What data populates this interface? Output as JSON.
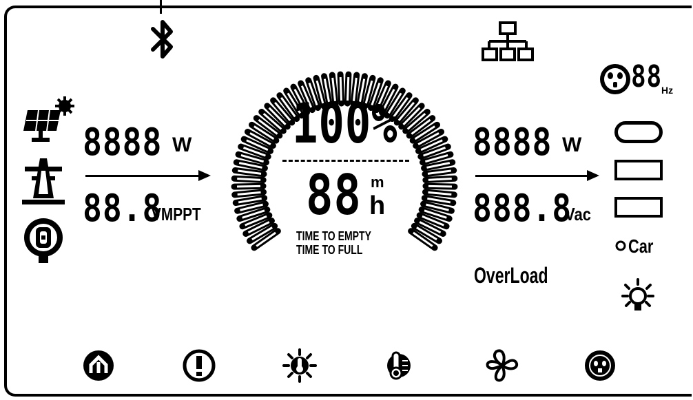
{
  "display": {
    "battery_percent": "100%",
    "time_value": "88",
    "time_unit_minutes": "m",
    "time_unit_hours": "h",
    "time_to_empty_label": "TIME TO EMPTY",
    "time_to_full_label": "TIME TO FULL",
    "gauge_segments": 60
  },
  "input": {
    "power_value": "8888",
    "power_unit": "W",
    "voltage_value": "88.8",
    "voltage_unit": "VMPPT"
  },
  "output": {
    "power_value": "8888",
    "power_unit": "W",
    "voltage_value": "888.8",
    "voltage_unit": "Vac",
    "frequency_value": "88",
    "frequency_unit": "Hz",
    "overload_label": "OverLoad",
    "car_label": "Car"
  },
  "icons": {
    "top": [
      "bluetooth-icon",
      "network-icon"
    ],
    "left": [
      "solar-panel-icon",
      "power-tower-icon",
      "dc-input-port-icon"
    ],
    "right": [
      "ac-outlet-icon",
      "usb-c-port-icon",
      "usb-a-port-icon",
      "usb-a-port-icon",
      "car-port-icon",
      "light-icon"
    ],
    "bottom": [
      "power-saving-icon",
      "warning-icon",
      "temperature-high-icon",
      "temperature-low-icon",
      "fan-icon",
      "ac-on-icon"
    ]
  }
}
